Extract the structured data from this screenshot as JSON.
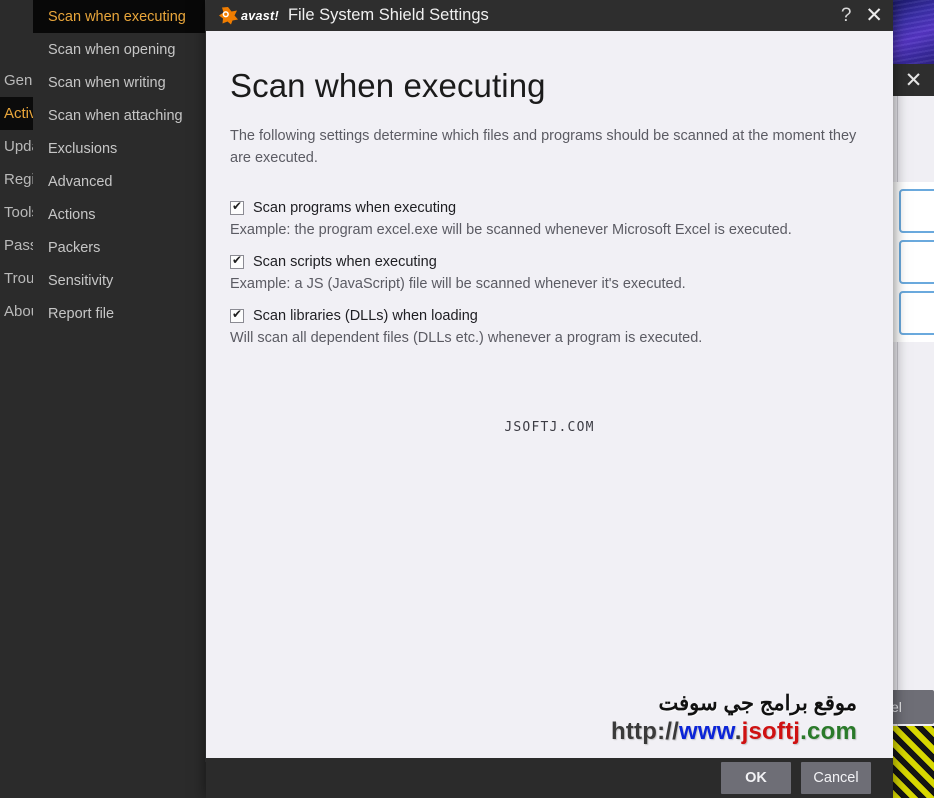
{
  "window": {
    "title": "File System Shield Settings",
    "logo_text": "avast!",
    "help_icon": "?",
    "close_icon": "✕"
  },
  "left_nav": {
    "items": [
      {
        "label": "Gene",
        "active": false
      },
      {
        "label": "Activ",
        "active": true
      },
      {
        "label": "Upda",
        "active": false
      },
      {
        "label": "Regis",
        "active": false
      },
      {
        "label": "Tools",
        "active": false
      },
      {
        "label": "Passv",
        "active": false
      },
      {
        "label": "Troul",
        "active": false
      },
      {
        "label": "Abou",
        "active": false
      }
    ]
  },
  "menu": {
    "items": [
      {
        "label": "Scan when executing",
        "selected": true
      },
      {
        "label": "Scan when opening",
        "selected": false
      },
      {
        "label": "Scan when writing",
        "selected": false
      },
      {
        "label": "Scan when attaching",
        "selected": false
      },
      {
        "label": "Exclusions",
        "selected": false
      },
      {
        "label": "Advanced",
        "selected": false
      },
      {
        "label": "Actions",
        "selected": false
      },
      {
        "label": "Packers",
        "selected": false
      },
      {
        "label": "Sensitivity",
        "selected": false
      },
      {
        "label": "Report file",
        "selected": false
      }
    ]
  },
  "page": {
    "title": "Scan when executing",
    "description": "The following settings determine which files and programs should be scanned at the moment they are executed.",
    "options": [
      {
        "label": "Scan programs when executing",
        "checked": true,
        "description": "Example: the program excel.exe will be scanned whenever Microsoft Excel is executed."
      },
      {
        "label": "Scan scripts when executing",
        "checked": true,
        "description": "Example: a JS (JavaScript) file will be scanned whenever it's executed."
      },
      {
        "label": "Scan libraries (DLLs) when loading",
        "checked": true,
        "description": "Will scan all dependent files (DLLs etc.) whenever a program is executed."
      }
    ]
  },
  "footer": {
    "ok_label": "OK",
    "cancel_label": "Cancel"
  },
  "watermarks": {
    "pixel_text": "JSOFTJ.COM",
    "arabic_text": "موقع برامج جي سوفت",
    "url_part1": "http://",
    "url_part2": "www",
    "url_dot": ".",
    "url_part3": "jsoftj",
    "url_part4": ".com"
  },
  "background": {
    "close_icon": "✕",
    "partial_button_label": "el"
  },
  "colors": {
    "accent_orange": "#e9a63b",
    "dialog_bg": "#f1f0f5",
    "titlebar": "#2e2e2e",
    "menu_bg": "#2b2b2b",
    "button_gray": "#6e6e76",
    "bg_box_blue": "#6aa9dd"
  }
}
